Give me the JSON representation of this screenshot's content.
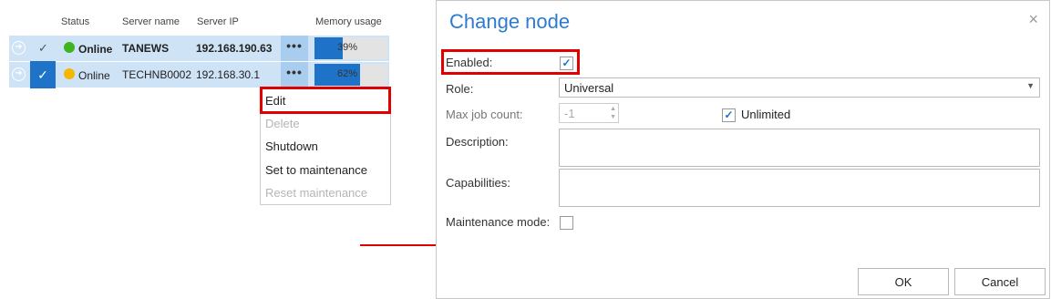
{
  "grid": {
    "headers": {
      "status": "Status",
      "server_name": "Server name",
      "server_ip": "Server IP",
      "memory": "Memory usage"
    },
    "rows": [
      {
        "status": "Online",
        "status_color": "#3cb521",
        "name": "TANEWS",
        "ip": "192.168.190.63",
        "more": "•••",
        "memory_label": "39%",
        "memory_percent": 39
      },
      {
        "status": "Online",
        "status_color": "#f5b700",
        "name": "TECHNB0002",
        "ip": "192.168.30.1",
        "more": "•••",
        "memory_label": "62%",
        "memory_percent": 62
      }
    ]
  },
  "context_menu": {
    "items": [
      {
        "label": "Edit",
        "enabled": true
      },
      {
        "label": "Delete",
        "enabled": false
      },
      {
        "label": "Shutdown",
        "enabled": true
      },
      {
        "label": "Set to maintenance",
        "enabled": true
      },
      {
        "label": "Reset maintenance",
        "enabled": false
      }
    ]
  },
  "dialog": {
    "title": "Change node",
    "close_icon": "×",
    "enabled_label": "Enabled:",
    "enabled_checked": true,
    "role_label": "Role:",
    "role_value": "Universal",
    "max_job_label": "Max job count:",
    "max_job_value": "-1",
    "unlimited_label": "Unlimited",
    "unlimited_checked": true,
    "description_label": "Description:",
    "capabilities_label": "Capabilities:",
    "maintenance_label": "Maintenance mode:",
    "maintenance_checked": false,
    "ok_label": "OK",
    "cancel_label": "Cancel"
  },
  "colors": {
    "accent": "#1e73c8",
    "title": "#2c7bd0",
    "highlight_red": "#e10000",
    "row_bg": "#cfe3f7"
  }
}
